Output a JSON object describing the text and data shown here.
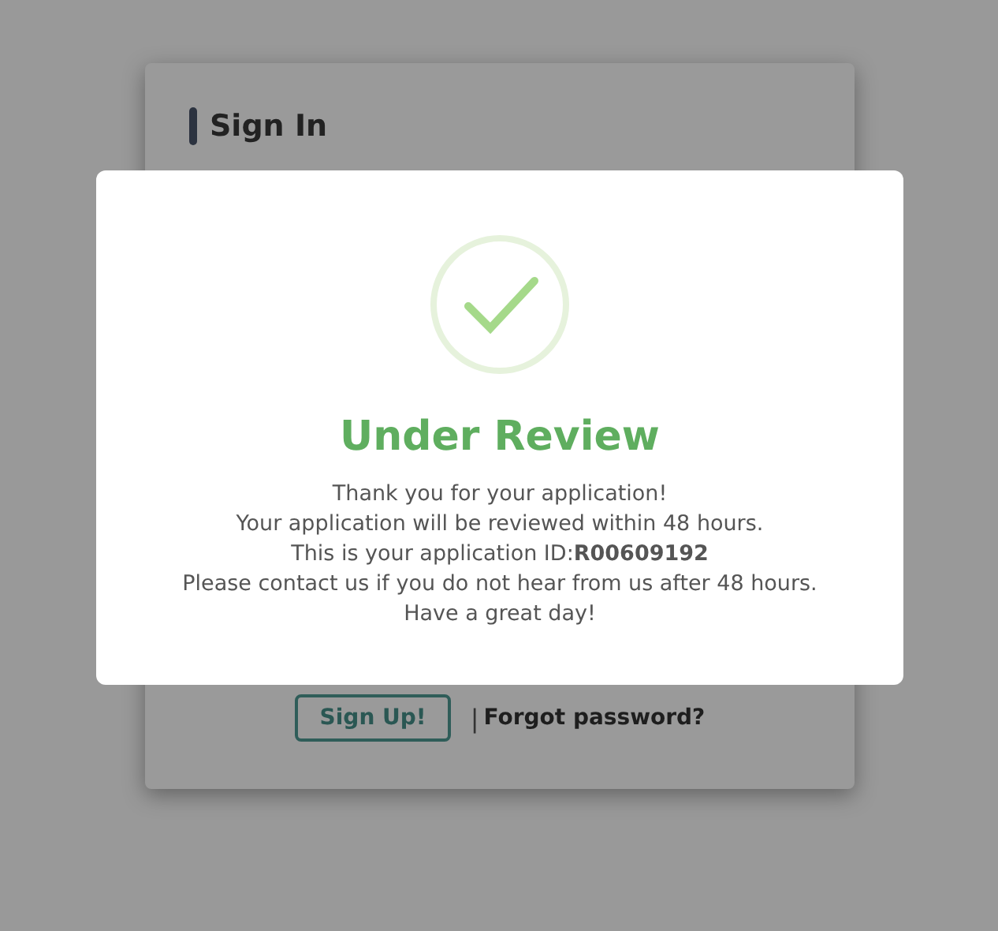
{
  "sign_in_card": {
    "title": "Sign In",
    "sign_up_button": "Sign Up!",
    "separator": "|",
    "forgot_password_link": "Forgot password?"
  },
  "dialog": {
    "title": "Under Review",
    "lines": [
      "Thank you for your application!",
      "Your application will be reviewed within 48 hours.",
      "This is your application ID:**R00609192**",
      "Please contact us if you do not hear from us after 48 hours.",
      "Have a great day!"
    ]
  }
}
